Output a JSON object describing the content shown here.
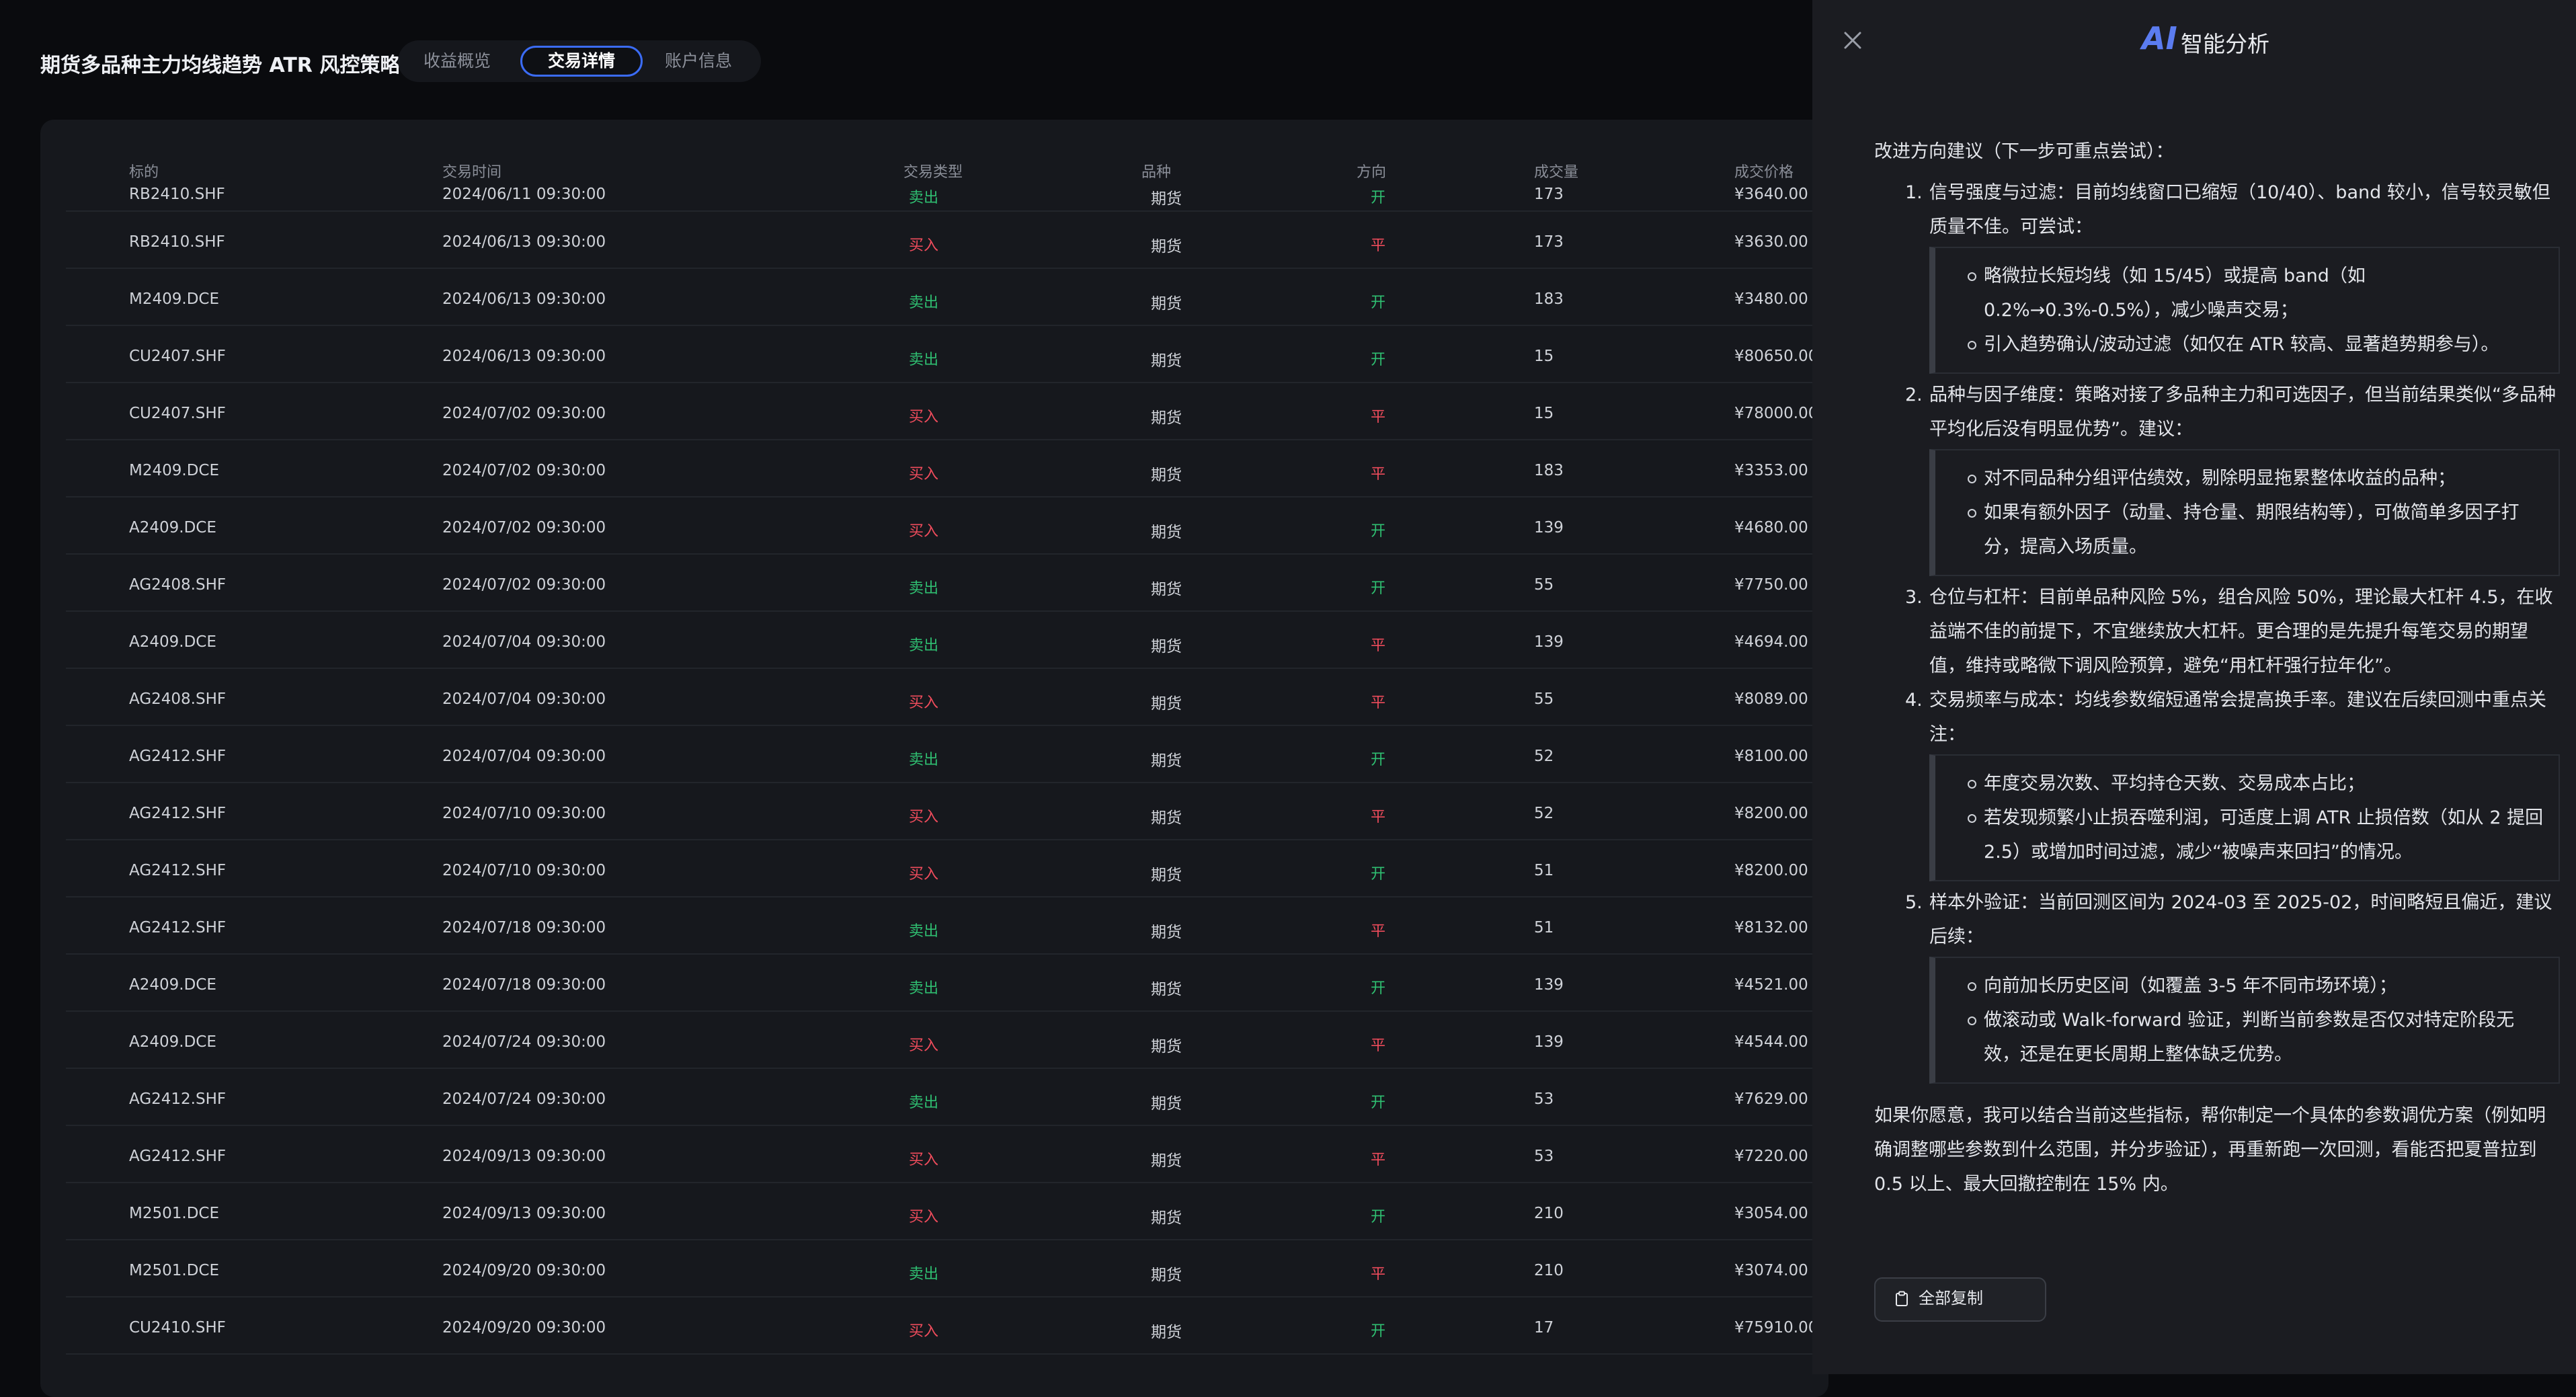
{
  "app": {
    "title": "期货多品种主力均线趋势 ATR 风控策略"
  },
  "tabs": [
    {
      "label": "收益概览"
    },
    {
      "label": "交易详情"
    },
    {
      "label": "账户信息"
    }
  ],
  "table": {
    "headers": [
      "标的",
      "交易时间",
      "交易类型",
      "品种",
      "方向",
      "成交量",
      "成交价格"
    ],
    "rows": [
      {
        "symbol": "RB2410.SHF",
        "time": "2024/06/11 09:30:00",
        "type": "卖出",
        "kind": "期货",
        "dir": "开",
        "vol": "173",
        "price": "¥3640.00"
      },
      {
        "symbol": "RB2410.SHF",
        "time": "2024/06/13 09:30:00",
        "type": "买入",
        "kind": "期货",
        "dir": "平",
        "vol": "173",
        "price": "¥3630.00"
      },
      {
        "symbol": "M2409.DCE",
        "time": "2024/06/13 09:30:00",
        "type": "卖出",
        "kind": "期货",
        "dir": "开",
        "vol": "183",
        "price": "¥3480.00"
      },
      {
        "symbol": "CU2407.SHF",
        "time": "2024/06/13 09:30:00",
        "type": "卖出",
        "kind": "期货",
        "dir": "开",
        "vol": "15",
        "price": "¥80650.00"
      },
      {
        "symbol": "CU2407.SHF",
        "time": "2024/07/02 09:30:00",
        "type": "买入",
        "kind": "期货",
        "dir": "平",
        "vol": "15",
        "price": "¥78000.00"
      },
      {
        "symbol": "M2409.DCE",
        "time": "2024/07/02 09:30:00",
        "type": "买入",
        "kind": "期货",
        "dir": "平",
        "vol": "183",
        "price": "¥3353.00"
      },
      {
        "symbol": "A2409.DCE",
        "time": "2024/07/02 09:30:00",
        "type": "买入",
        "kind": "期货",
        "dir": "开",
        "vol": "139",
        "price": "¥4680.00"
      },
      {
        "symbol": "AG2408.SHF",
        "time": "2024/07/02 09:30:00",
        "type": "卖出",
        "kind": "期货",
        "dir": "开",
        "vol": "55",
        "price": "¥7750.00"
      },
      {
        "symbol": "A2409.DCE",
        "time": "2024/07/04 09:30:00",
        "type": "卖出",
        "kind": "期货",
        "dir": "平",
        "vol": "139",
        "price": "¥4694.00"
      },
      {
        "symbol": "AG2408.SHF",
        "time": "2024/07/04 09:30:00",
        "type": "买入",
        "kind": "期货",
        "dir": "平",
        "vol": "55",
        "price": "¥8089.00"
      },
      {
        "symbol": "AG2412.SHF",
        "time": "2024/07/04 09:30:00",
        "type": "卖出",
        "kind": "期货",
        "dir": "开",
        "vol": "52",
        "price": "¥8100.00"
      },
      {
        "symbol": "AG2412.SHF",
        "time": "2024/07/10 09:30:00",
        "type": "买入",
        "kind": "期货",
        "dir": "平",
        "vol": "52",
        "price": "¥8200.00"
      },
      {
        "symbol": "AG2412.SHF",
        "time": "2024/07/10 09:30:00",
        "type": "买入",
        "kind": "期货",
        "dir": "开",
        "vol": "51",
        "price": "¥8200.00"
      },
      {
        "symbol": "AG2412.SHF",
        "time": "2024/07/18 09:30:00",
        "type": "卖出",
        "kind": "期货",
        "dir": "平",
        "vol": "51",
        "price": "¥8132.00"
      },
      {
        "symbol": "A2409.DCE",
        "time": "2024/07/18 09:30:00",
        "type": "卖出",
        "kind": "期货",
        "dir": "开",
        "vol": "139",
        "price": "¥4521.00"
      },
      {
        "symbol": "A2409.DCE",
        "time": "2024/07/24 09:30:00",
        "type": "买入",
        "kind": "期货",
        "dir": "平",
        "vol": "139",
        "price": "¥4544.00"
      },
      {
        "symbol": "AG2412.SHF",
        "time": "2024/07/24 09:30:00",
        "type": "卖出",
        "kind": "期货",
        "dir": "开",
        "vol": "53",
        "price": "¥7629.00"
      },
      {
        "symbol": "AG2412.SHF",
        "time": "2024/09/13 09:30:00",
        "type": "买入",
        "kind": "期货",
        "dir": "平",
        "vol": "53",
        "price": "¥7220.00"
      },
      {
        "symbol": "M2501.DCE",
        "time": "2024/09/13 09:30:00",
        "type": "买入",
        "kind": "期货",
        "dir": "开",
        "vol": "210",
        "price": "¥3054.00"
      },
      {
        "symbol": "M2501.DCE",
        "time": "2024/09/20 09:30:00",
        "type": "卖出",
        "kind": "期货",
        "dir": "平",
        "vol": "210",
        "price": "¥3074.00"
      },
      {
        "symbol": "CU2410.SHF",
        "time": "2024/09/20 09:30:00",
        "type": "买入",
        "kind": "期货",
        "dir": "开",
        "vol": "17",
        "price": "¥75910.00"
      }
    ]
  },
  "ai_panel": {
    "logo": "AI",
    "title": "智能分析",
    "intro": "改进方向建议（下一步可重点尝试）：",
    "items": [
      {
        "num": "1.",
        "text": "信号强度与过滤：目前均线窗口已缩短（10/40）、band 较小，信号较灵敏但质量不佳。可尝试：",
        "bullets": [
          "略微拉长短均线（如 15/45）或提高 band（如 0.2%→0.3%-0.5%），减少噪声交易；",
          "引入趋势确认/波动过滤（如仅在 ATR 较高、显著趋势期参与）。"
        ]
      },
      {
        "num": "2.",
        "text": "品种与因子维度：策略对接了多品种主力和可选因子，但当前结果类似“多品种平均化后没有明显优势”。建议：",
        "bullets": [
          "对不同品种分组评估绩效，剔除明显拖累整体收益的品种；",
          "如果有额外因子（动量、持仓量、期限结构等），可做简单多因子打分，提高入场质量。"
        ]
      },
      {
        "num": "3.",
        "text": "仓位与杠杆：目前单品种风险 5%，组合风险 50%，理论最大杠杆 4.5，在收益端不佳的前提下，不宜继续放大杠杆。更合理的是先提升每笔交易的期望值，维持或略微下调风险预算，避免“用杠杆强行拉年化”。",
        "bullets": []
      },
      {
        "num": "4.",
        "text": "交易频率与成本：均线参数缩短通常会提高换手率。建议在后续回测中重点关注：",
        "bullets": [
          "年度交易次数、平均持仓天数、交易成本占比；",
          "若发现频繁小止损吞噬利润，可适度上调 ATR 止损倍数（如从 2 提回 2.5）或增加时间过滤，减少“被噪声来回扫”的情况。"
        ]
      },
      {
        "num": "5.",
        "text": "样本外验证：当前回测区间为 2024-03 至 2025-02，时间略短且偏近，建议后续：",
        "bullets": [
          "向前加长历史区间（如覆盖 3-5 年不同市场环境）；",
          "做滚动或 Walk-forward 验证，判断当前参数是否仅对特定阶段无效，还是在更长周期上整体缺乏优势。"
        ]
      }
    ],
    "outro": "如果你愿意，我可以结合当前这些指标，帮你制定一个具体的参数调优方案（例如明确调整哪些参数到什么范围，并分步验证），再重新跑一次回测，看能否把夏普拉到 0.5 以上、最大回撤控制在 15% 内。",
    "copy_label": "全部复制"
  },
  "colors": {
    "accent": "#3b6cf6",
    "sell": "#2fbf71",
    "buy": "#ef4c5c"
  }
}
